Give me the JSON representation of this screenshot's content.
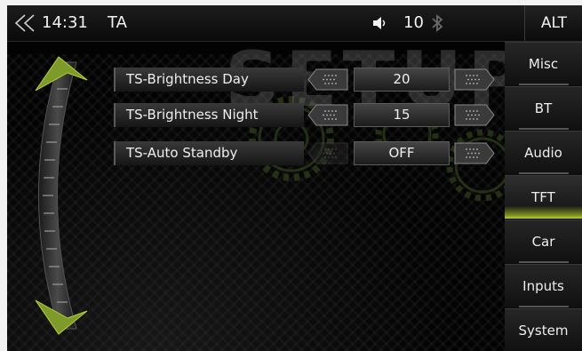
{
  "topbar": {
    "time": "14:31",
    "source": "TA",
    "volume": "10",
    "alt_label": "ALT",
    "back_icon": "back-chevron-icon",
    "volume_icon": "speaker-icon",
    "bluetooth_icon": "bluetooth-icon"
  },
  "watermark": "SETUP",
  "settings": [
    {
      "label": "TS-Brightness Day",
      "value": "20"
    },
    {
      "label": "TS-Brightness Night",
      "value": "15"
    },
    {
      "label": "TS-Auto Standby",
      "value": "OFF"
    }
  ],
  "tabs": [
    {
      "label": "Misc"
    },
    {
      "label": "BT"
    },
    {
      "label": "Audio"
    },
    {
      "label": "TFT",
      "active": true
    },
    {
      "label": "Car"
    },
    {
      "label": "Inputs"
    },
    {
      "label": "System"
    }
  ],
  "colors": {
    "accent": "#b8d13a",
    "background": "#030303"
  }
}
